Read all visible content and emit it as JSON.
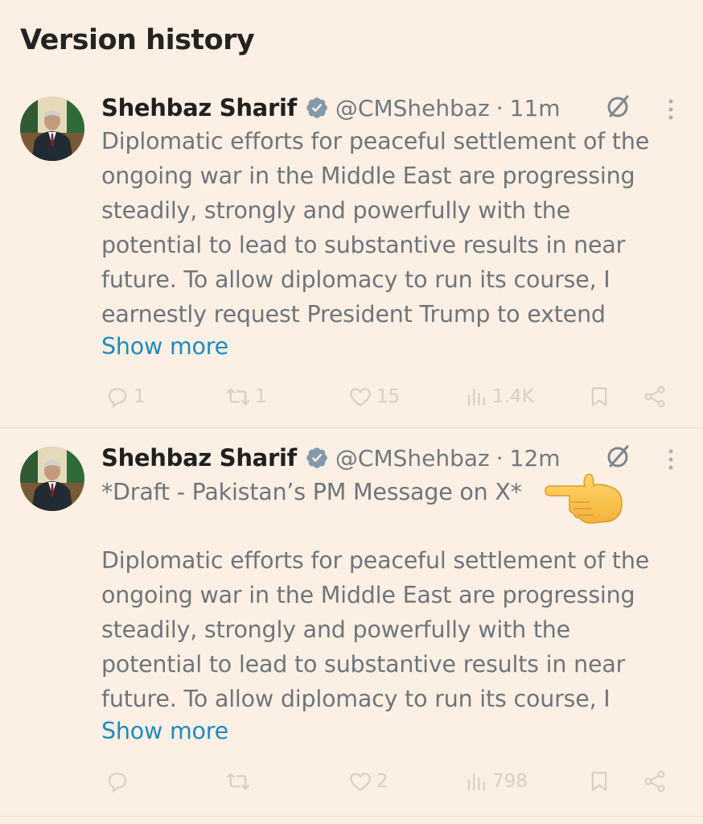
{
  "page_title": "Version history",
  "tweets": [
    {
      "author_name": "Shehbaz Sharif",
      "handle": "@CMShehbaz",
      "separator": "·",
      "time": "11m",
      "lines": [
        "Diplomatic efforts for peaceful settlement of the",
        "ongoing war in the Middle East are progressing",
        "steadily, strongly and powerfully with the",
        "potential to lead to substantive results in near",
        "future. To allow diplomacy to run its course, I",
        "earnestly request President Trump to extend"
      ],
      "show_more": "Show more",
      "stats": {
        "replies": "1",
        "reposts": "1",
        "likes": "15",
        "views": "1.4K"
      }
    },
    {
      "author_name": "Shehbaz Sharif",
      "handle": "@CMShehbaz",
      "separator": "·",
      "time": "12m",
      "draft_line": "*Draft - Pakistan’s PM Message on X*",
      "lines": [
        "Diplomatic efforts for peaceful settlement of the",
        "ongoing war in the Middle East are progressing",
        "steadily, strongly and powerfully with the",
        "potential to lead to substantive results in near",
        "future. To allow diplomacy to run its course, I"
      ],
      "show_more": "Show more",
      "stats": {
        "replies": "",
        "reposts": "",
        "likes": "2",
        "views": "798"
      }
    }
  ],
  "icons": {
    "verified": "verified-badge-icon",
    "edit_history": "edit-history-icon",
    "more": "more-options-icon",
    "reply": "reply-icon",
    "repost": "repost-icon",
    "like": "like-icon",
    "views": "views-icon",
    "bookmark": "bookmark-icon",
    "share": "share-icon",
    "pointer": "pointing-hand-emoji"
  },
  "colors": {
    "background": "#fcefe3",
    "link": "#1d8ac0",
    "muted_text": "#6e757c",
    "verified": "#829aab",
    "action_icons": "#d9cfc7"
  }
}
